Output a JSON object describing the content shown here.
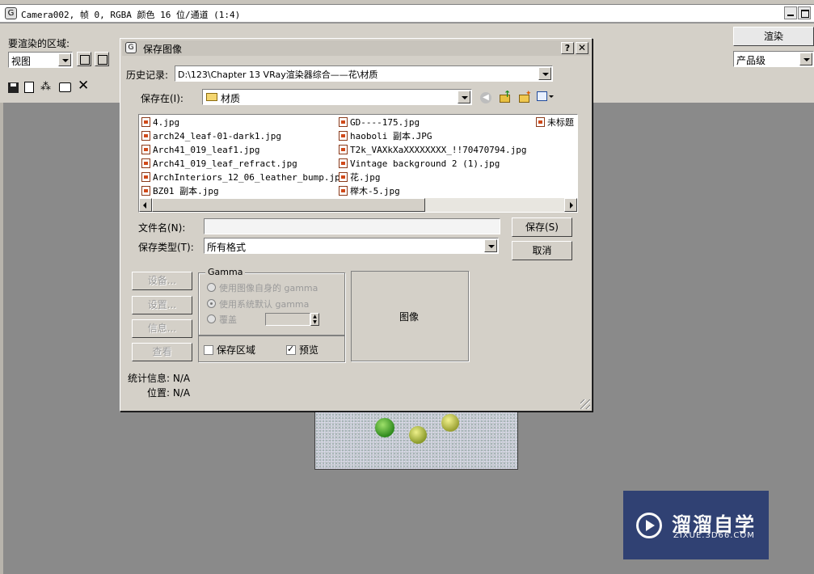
{
  "app": {
    "title": "Camera002, 帧 0, RGBA 颜色 16 位/通道 (1:4)",
    "render_area_label": "要渲染的区域:",
    "render_area_value": "视图",
    "render_button": "渲染",
    "quality_value": "产品级"
  },
  "dialog": {
    "title": "保存图像",
    "history_label": "历史记录:",
    "history_value": "D:\\123\\Chapter 13 VRay渲染器综合——花\\材质",
    "save_in_label": "保存在(I):",
    "save_in_value": "材质",
    "files_col1": [
      "4.jpg",
      "arch24_leaf-01-dark1.jpg",
      "Arch41_019_leaf1.jpg",
      "Arch41_019_leaf_refract.jpg",
      "ArchInteriors_12_06_leather_bump.jpg",
      "BZ01 副本.jpg"
    ],
    "files_col2": [
      "GD----175.jpg",
      "haoboli 副本.JPG",
      "T2k_VAXkXaXXXXXXXX_!!70470794.jpg",
      "Vintage background 2 (1).jpg",
      "花.jpg",
      "榉木-5.jpg"
    ],
    "files_col3": [
      "未标题"
    ],
    "filename_label": "文件名(N):",
    "filename_value": "",
    "filetype_label": "保存类型(T):",
    "filetype_value": "所有格式",
    "save_button": "保存(S)",
    "cancel_button": "取消",
    "setup_button": "设备...",
    "settings_button": "设置...",
    "info_button": "信息...",
    "view_button": "查看",
    "gamma_group": "Gamma",
    "gamma_opt1": "使用图像自身的 gamma",
    "gamma_opt2": "使用系统默认 gamma",
    "gamma_opt3": "覆盖",
    "save_region_label": "保存区域",
    "preview_label": "预览",
    "image_preview_label": "图像",
    "stats_label": "统计信息: N/A",
    "position_label": "位置: N/A"
  },
  "watermark": {
    "brand": "溜溜自学",
    "url": "ZIXUE.3D66.COM"
  }
}
